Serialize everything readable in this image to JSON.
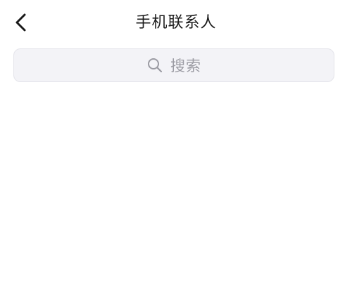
{
  "header": {
    "title": "手机联系人",
    "back_icon": "chevron-left-icon"
  },
  "search": {
    "placeholder": "搜索",
    "icon": "search-icon"
  },
  "colors": {
    "background": "#ffffff",
    "search_bg": "#f3f3f7",
    "title_text": "#1a1a1a",
    "placeholder_text": "#9b9ba3"
  }
}
